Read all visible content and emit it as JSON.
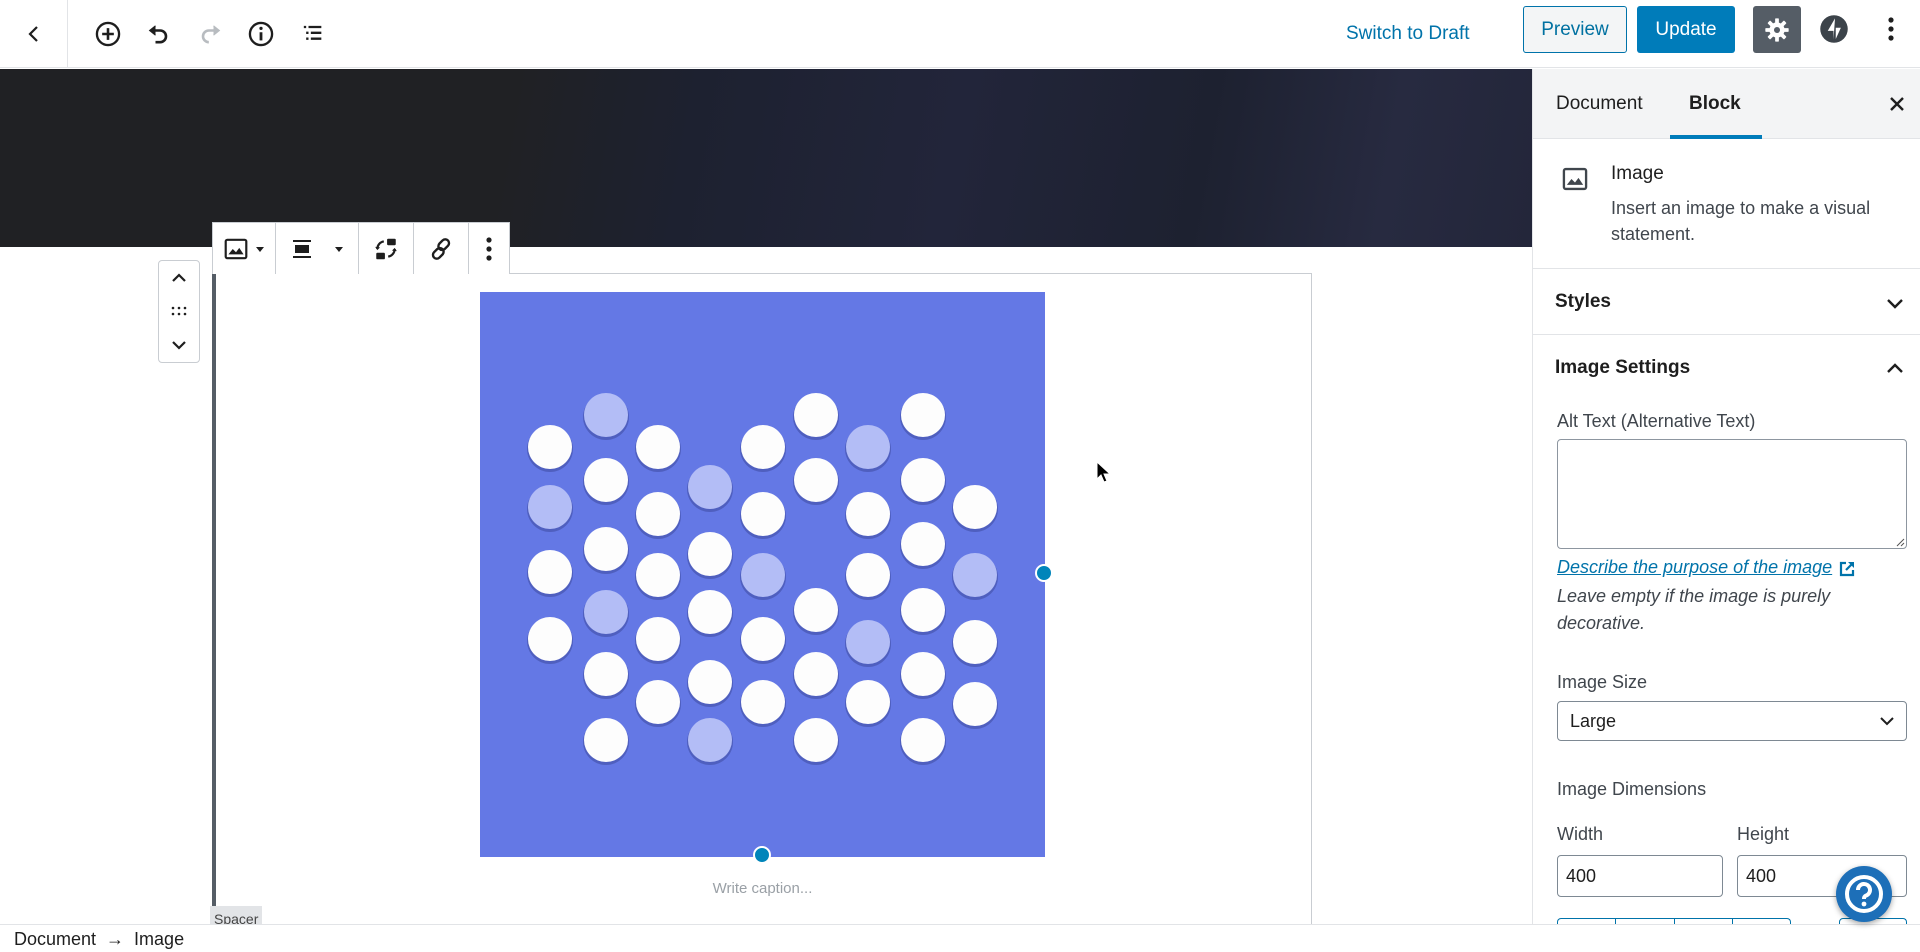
{
  "topbar": {
    "back_icon": "chevron-left-icon",
    "tools": [
      {
        "name": "add-block",
        "icon": "plus-circle-icon"
      },
      {
        "name": "undo",
        "icon": "undo-icon"
      },
      {
        "name": "redo",
        "icon": "redo-icon",
        "disabled": true
      },
      {
        "name": "content-info",
        "icon": "info-icon"
      },
      {
        "name": "block-navigation",
        "icon": "list-icon"
      }
    ],
    "switch_to_draft": "Switch to Draft",
    "preview": "Preview",
    "update": "Update",
    "settings_icon": "gear-icon",
    "jetpack_icon": "jetpack-icon",
    "more_icon": "more-vertical-icon"
  },
  "block_toolbar": {
    "items": [
      {
        "name": "block-type",
        "icon": "image-icon",
        "has_dropdown": true
      },
      {
        "name": "alignment",
        "icon": "align-center-icon",
        "has_dropdown": true
      },
      {
        "name": "replace",
        "icon": "replace-icon"
      },
      {
        "name": "link",
        "icon": "link-icon"
      },
      {
        "name": "more-options",
        "icon": "more-vertical-icon"
      }
    ]
  },
  "mover": {
    "up_icon": "chevron-up-icon",
    "drag_icon": "drag-handle-icon",
    "down_icon": "chevron-down-icon"
  },
  "image_block": {
    "caption_placeholder": "Write caption...",
    "background_color": "#6478e5",
    "next_block_label": "Spacer"
  },
  "footer": {
    "breadcrumb": [
      "Document",
      "Image"
    ],
    "separator": "→"
  },
  "sidebar": {
    "tabs": [
      {
        "label": "Document",
        "active": false
      },
      {
        "label": "Block",
        "active": true
      }
    ],
    "close_icon": "close-icon",
    "block_card": {
      "icon": "image-icon",
      "title": "Image",
      "description": "Insert an image to make a visual statement."
    },
    "panels": [
      {
        "title": "Styles",
        "expanded": false
      },
      {
        "title": "Image Settings",
        "expanded": true
      }
    ],
    "image_settings": {
      "alt_label": "Alt Text (Alternative Text)",
      "alt_value": "",
      "help_link": "Describe the purpose of the image",
      "help_text": "Leave empty if the image is purely decorative.",
      "size_label": "Image Size",
      "size_value": "Large",
      "dimensions_label": "Image Dimensions",
      "width_label": "Width",
      "width_value": "400",
      "height_label": "Height",
      "height_value": "400"
    }
  },
  "help_fab": {
    "icon": "help-icon"
  },
  "colors": {
    "accent": "#007cba",
    "link": "#0073aa",
    "settings_active": "#555d66",
    "handle": "#0085ba"
  }
}
